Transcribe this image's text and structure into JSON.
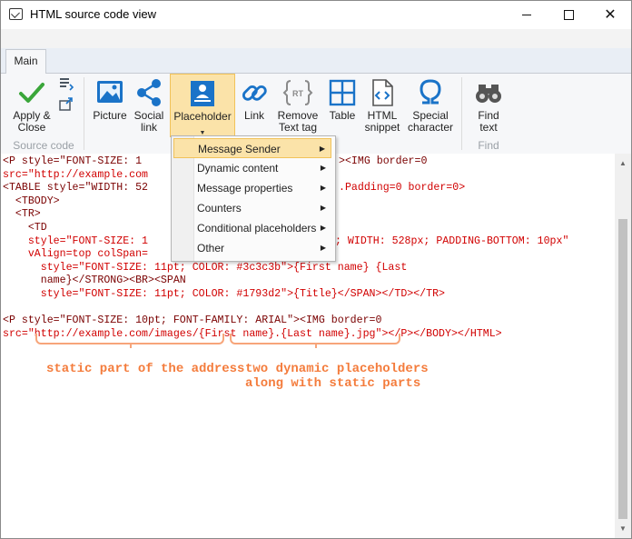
{
  "window": {
    "title": "HTML source code view"
  },
  "tabs": [
    {
      "label": "Main"
    }
  ],
  "ribbon": {
    "apply_close": "Apply &\nClose",
    "group_source_code": "Source code",
    "picture": "Picture",
    "social_link": "Social\nlink",
    "placeholder": "Placeholder",
    "link": "Link",
    "remove_text_tag": "Remove\nText tag",
    "table": "Table",
    "html_snippet": "HTML\nsnippet",
    "special_character": "Special\ncharacter",
    "find_text": "Find\ntext",
    "group_find": "Find",
    "rt_glyph": "RT"
  },
  "menu": {
    "items": [
      {
        "label": "Message Sender"
      },
      {
        "label": "Dynamic content"
      },
      {
        "label": "Message properties"
      },
      {
        "label": "Counters"
      },
      {
        "label": "Conditional placeholders"
      },
      {
        "label": "Other"
      }
    ]
  },
  "code": {
    "l1a": "<P style=\"FONT-SIZE: 1",
    "l1b": "><IMG border=0",
    "l2": "src=\"http://example.com",
    "l3a": "<TABLE style=\"WIDTH: 52",
    "l3b": ".Padding=0 border=0>",
    "l4": "  <TBODY>",
    "l5": "  <TR>",
    "l6": "    <TD",
    "l7a": "    style=\"FONT-SIZE: 1",
    "l7b": "; WIDTH: 528px; PADDING-BOTTOM: 10px\"",
    "l8a": "    vAlign=top colSpan=",
    "l9": "      style=\"FONT-SIZE: 11pt; COLOR: #3c3c3b\">{First name} {Last",
    "l10": "      name}</STRONG><BR><SPAN",
    "l11": "      style=\"FONT-SIZE: 11pt; COLOR: #1793d2\">{Title}</SPAN></TD></TR>",
    "l12": "<P style=\"FONT-SIZE: 10pt; FONT-FAMILY: ARIAL\"><IMG border=0",
    "l13": "src=\"http://example.com/images/{First name}.{Last name}.jpg\"></P></BODY></HTML>"
  },
  "annotations": {
    "static": "static part of the address",
    "dynamic": "two dynamic placeholders\nalong with static parts"
  },
  "colors": {
    "accent": "#f47c3c",
    "highlight": "#fbe3a9",
    "tag": "#7a0000",
    "attr": "#d10000",
    "value": "#0000cc"
  }
}
